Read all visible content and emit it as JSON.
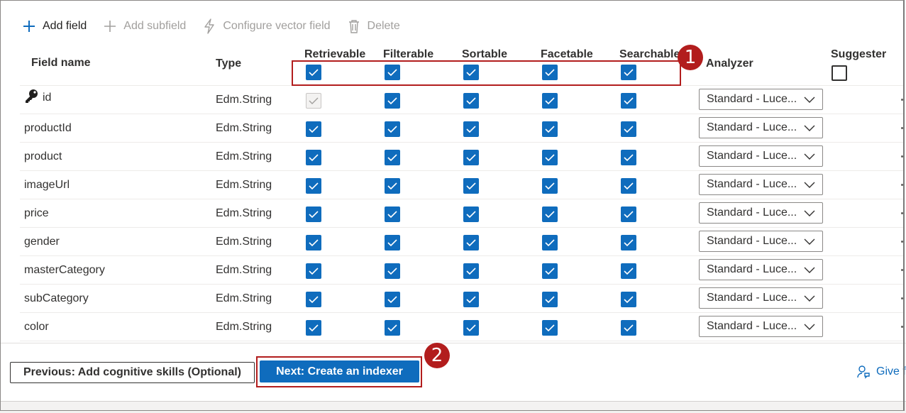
{
  "toolbar": {
    "add_field": "Add field",
    "add_subfield": "Add subfield",
    "configure_vector": "Configure vector field",
    "delete": "Delete"
  },
  "columns": {
    "field_name": "Field name",
    "type": "Type",
    "retrievable": "Retrievable",
    "filterable": "Filterable",
    "sortable": "Sortable",
    "facetable": "Facetable",
    "searchable": "Searchable",
    "analyzer": "Analyzer",
    "suggester": "Suggester"
  },
  "header_checks": {
    "retrievable": true,
    "filterable": true,
    "sortable": true,
    "facetable": true,
    "searchable": true,
    "suggester": false
  },
  "rows": [
    {
      "name": "id",
      "type": "Edm.String",
      "key": true,
      "analyzer": "Standard - Luce..."
    },
    {
      "name": "productId",
      "type": "Edm.String",
      "key": false,
      "analyzer": "Standard - Luce..."
    },
    {
      "name": "product",
      "type": "Edm.String",
      "key": false,
      "analyzer": "Standard - Luce..."
    },
    {
      "name": "imageUrl",
      "type": "Edm.String",
      "key": false,
      "analyzer": "Standard - Luce..."
    },
    {
      "name": "price",
      "type": "Edm.String",
      "key": false,
      "analyzer": "Standard - Luce..."
    },
    {
      "name": "gender",
      "type": "Edm.String",
      "key": false,
      "analyzer": "Standard - Luce..."
    },
    {
      "name": "masterCategory",
      "type": "Edm.String",
      "key": false,
      "analyzer": "Standard - Luce..."
    },
    {
      "name": "subCategory",
      "type": "Edm.String",
      "key": false,
      "analyzer": "Standard - Luce..."
    },
    {
      "name": "color",
      "type": "Edm.String",
      "key": false,
      "analyzer": "Standard - Luce..."
    }
  ],
  "annotations": {
    "one": "1",
    "two": "2"
  },
  "footer": {
    "prev": "Previous: Add cognitive skills (Optional)",
    "next": "Next: Create an indexer",
    "feedback": "Give f"
  },
  "colors": {
    "accent": "#0f6cbd",
    "annotation": "#b21d1d"
  },
  "icons": {
    "add": "plus-icon",
    "subfield": "plus-icon",
    "vector": "lightning-icon",
    "delete": "trash-icon",
    "key": "key-icon",
    "chevron": "chevron-down-icon",
    "check": "checkmark-icon",
    "feedback": "feedback-person-icon"
  }
}
